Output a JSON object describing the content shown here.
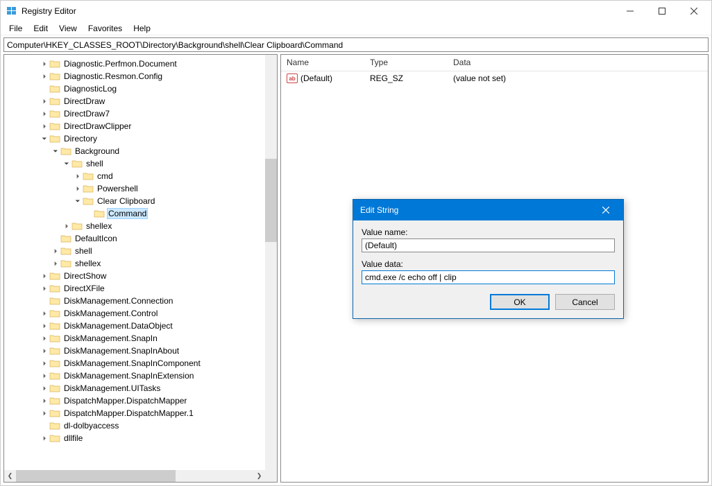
{
  "app": {
    "title": "Registry Editor"
  },
  "menu": {
    "file": "File",
    "edit": "Edit",
    "view": "View",
    "favorites": "Favorites",
    "help": "Help"
  },
  "address": "Computer\\HKEY_CLASSES_ROOT\\Directory\\Background\\shell\\Clear Clipboard\\Command",
  "columns": {
    "name": "Name",
    "type": "Type",
    "data": "Data"
  },
  "tree": [
    {
      "label": "Diagnostic.Perfmon.Document",
      "indent": 3,
      "expandable": true,
      "open": false
    },
    {
      "label": "Diagnostic.Resmon.Config",
      "indent": 3,
      "expandable": true,
      "open": false
    },
    {
      "label": "DiagnosticLog",
      "indent": 3,
      "expandable": false,
      "open": false
    },
    {
      "label": "DirectDraw",
      "indent": 3,
      "expandable": true,
      "open": false
    },
    {
      "label": "DirectDraw7",
      "indent": 3,
      "expandable": true,
      "open": false
    },
    {
      "label": "DirectDrawClipper",
      "indent": 3,
      "expandable": true,
      "open": false
    },
    {
      "label": "Directory",
      "indent": 3,
      "expandable": true,
      "open": true
    },
    {
      "label": "Background",
      "indent": 4,
      "expandable": true,
      "open": true
    },
    {
      "label": "shell",
      "indent": 5,
      "expandable": true,
      "open": true
    },
    {
      "label": "cmd",
      "indent": 6,
      "expandable": true,
      "open": false
    },
    {
      "label": "Powershell",
      "indent": 6,
      "expandable": true,
      "open": false
    },
    {
      "label": "Clear Clipboard",
      "indent": 6,
      "expandable": true,
      "open": true
    },
    {
      "label": "Command",
      "indent": 7,
      "expandable": false,
      "open": false,
      "selected": true
    },
    {
      "label": "shellex",
      "indent": 5,
      "expandable": true,
      "open": false
    },
    {
      "label": "DefaultIcon",
      "indent": 4,
      "expandable": false,
      "open": false
    },
    {
      "label": "shell",
      "indent": 4,
      "expandable": true,
      "open": false
    },
    {
      "label": "shellex",
      "indent": 4,
      "expandable": true,
      "open": false
    },
    {
      "label": "DirectShow",
      "indent": 3,
      "expandable": true,
      "open": false
    },
    {
      "label": "DirectXFile",
      "indent": 3,
      "expandable": true,
      "open": false
    },
    {
      "label": "DiskManagement.Connection",
      "indent": 3,
      "expandable": false,
      "open": false
    },
    {
      "label": "DiskManagement.Control",
      "indent": 3,
      "expandable": true,
      "open": false
    },
    {
      "label": "DiskManagement.DataObject",
      "indent": 3,
      "expandable": true,
      "open": false
    },
    {
      "label": "DiskManagement.SnapIn",
      "indent": 3,
      "expandable": true,
      "open": false
    },
    {
      "label": "DiskManagement.SnapInAbout",
      "indent": 3,
      "expandable": true,
      "open": false
    },
    {
      "label": "DiskManagement.SnapInComponent",
      "indent": 3,
      "expandable": true,
      "open": false
    },
    {
      "label": "DiskManagement.SnapInExtension",
      "indent": 3,
      "expandable": true,
      "open": false
    },
    {
      "label": "DiskManagement.UITasks",
      "indent": 3,
      "expandable": true,
      "open": false
    },
    {
      "label": "DispatchMapper.DispatchMapper",
      "indent": 3,
      "expandable": true,
      "open": false
    },
    {
      "label": "DispatchMapper.DispatchMapper.1",
      "indent": 3,
      "expandable": true,
      "open": false
    },
    {
      "label": "dl-dolbyaccess",
      "indent": 3,
      "expandable": false,
      "open": false
    },
    {
      "label": "dllfile",
      "indent": 3,
      "expandable": true,
      "open": false
    }
  ],
  "values": [
    {
      "name": "(Default)",
      "type": "REG_SZ",
      "data": "(value not set)"
    }
  ],
  "dialog": {
    "title": "Edit String",
    "value_name_label": "Value name:",
    "value_name": "(Default)",
    "value_data_label": "Value data:",
    "value_data": "cmd.exe /c echo off | clip",
    "ok": "OK",
    "cancel": "Cancel"
  }
}
